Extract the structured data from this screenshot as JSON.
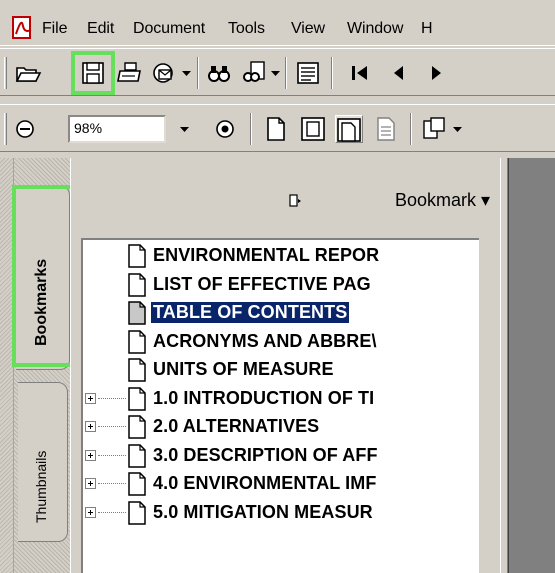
{
  "menu": {
    "items": [
      "File",
      "Edit",
      "Document",
      "Tools",
      "View",
      "Window",
      "H"
    ]
  },
  "toolbar": {
    "zoom_value": "98%",
    "buttons": [
      "open-icon",
      "save-icon",
      "print-icon",
      "email-icon",
      "search-icon",
      "find-icon",
      "page-view-icon",
      "first-page-icon",
      "prev-page-icon",
      "next-page-icon"
    ],
    "highlight_color": "#66e05c"
  },
  "nav_tabs": {
    "bookmarks": "Bookmarks",
    "thumbnails": "Thumbnails"
  },
  "bookmarks_panel": {
    "title": "Bookmark ▾",
    "items": [
      {
        "label": "ENVIRONMENTAL REPOR",
        "expandable": false,
        "selected": false
      },
      {
        "label": "LIST OF EFFECTIVE PAG",
        "expandable": false,
        "selected": false
      },
      {
        "label": "TABLE OF CONTENTS",
        "expandable": false,
        "selected": true
      },
      {
        "label": "ACRONYMS AND ABBRE\\",
        "expandable": false,
        "selected": false
      },
      {
        "label": "UNITS OF MEASURE",
        "expandable": false,
        "selected": false
      },
      {
        "label": "1.0 INTRODUCTION OF TI",
        "expandable": true,
        "selected": false
      },
      {
        "label": "2.0 ALTERNATIVES",
        "expandable": true,
        "selected": false
      },
      {
        "label": "3.0 DESCRIPTION OF AFF",
        "expandable": true,
        "selected": false
      },
      {
        "label": "4.0 ENVIRONMENTAL IMF",
        "expandable": true,
        "selected": false
      },
      {
        "label": "5.0 MITIGATION MEASUR",
        "expandable": true,
        "selected": false
      }
    ]
  },
  "colors": {
    "chrome": "#d4d0c8",
    "selection": "#0a246a",
    "highlight": "#66e05c"
  }
}
